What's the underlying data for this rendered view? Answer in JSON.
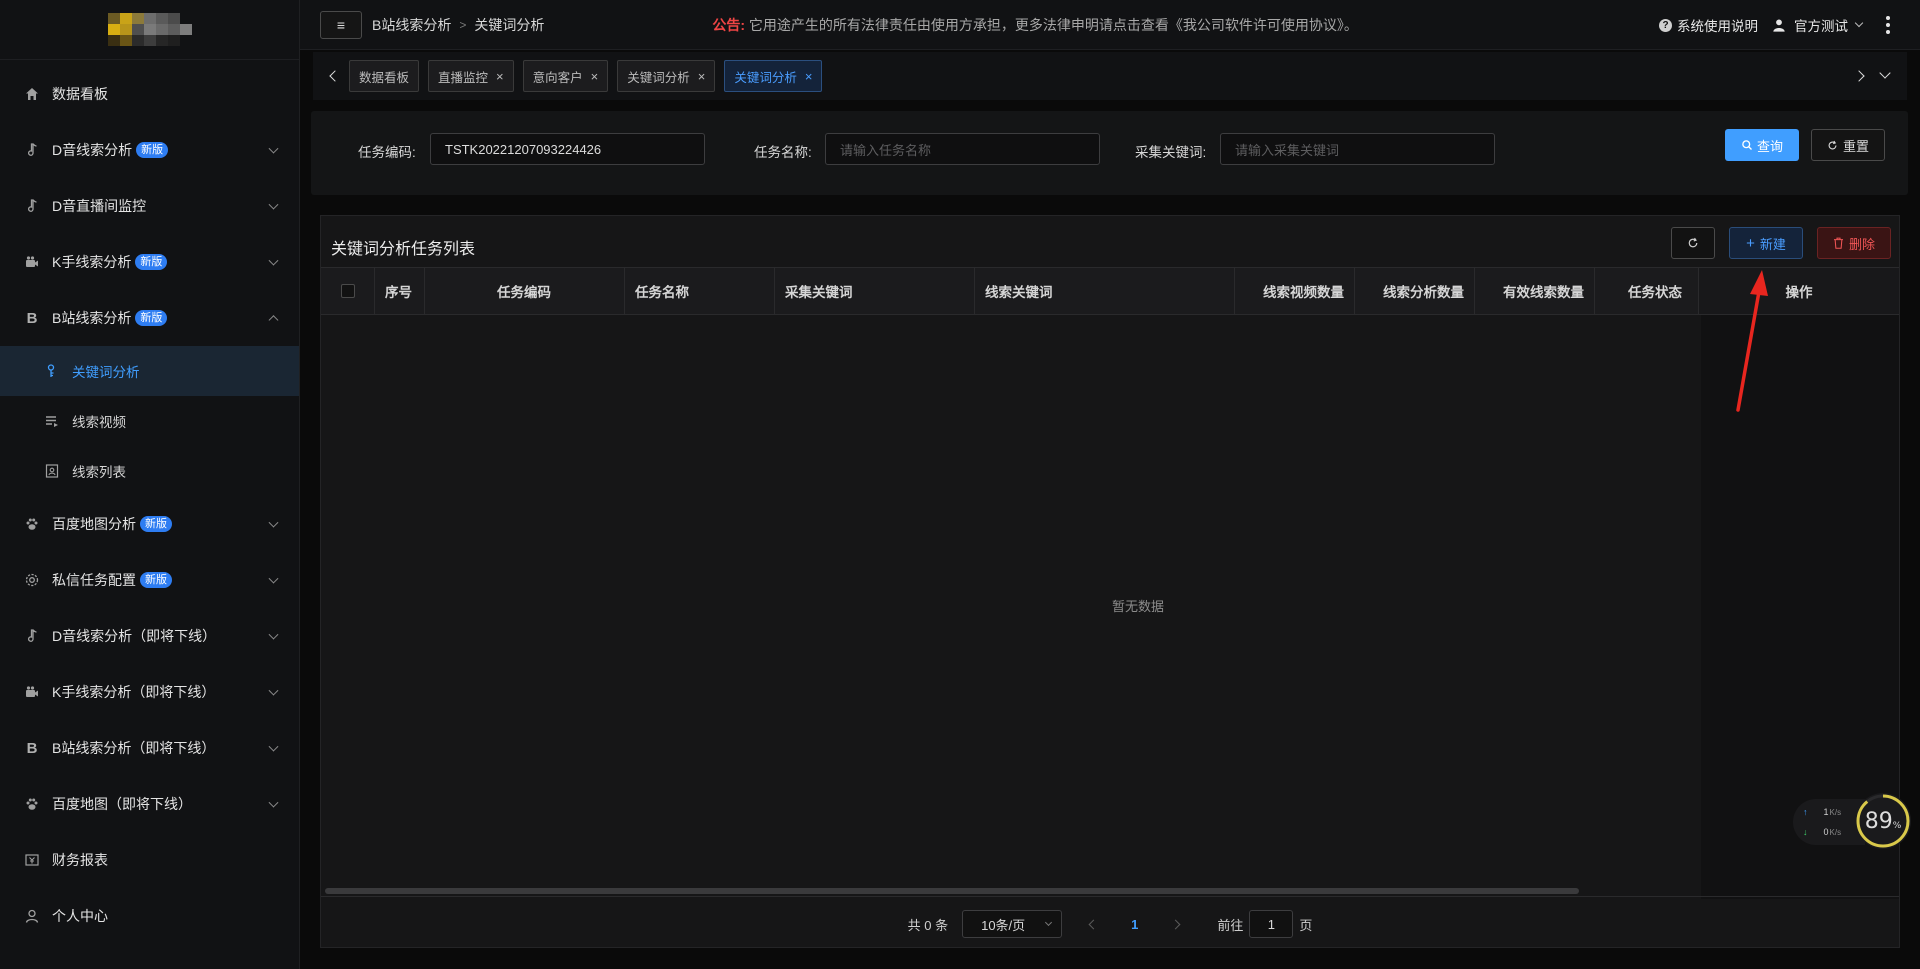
{
  "sidebar": {
    "items": [
      {
        "label": "数据看板",
        "icon": "home-icon"
      },
      {
        "label": "D音线索分析",
        "icon": "music-note-icon",
        "badge": "新版"
      },
      {
        "label": "D音直播间监控",
        "icon": "music-note-icon"
      },
      {
        "label": "K手线索分析",
        "icon": "camera-icon",
        "badge": "新版"
      },
      {
        "label": "B站线索分析",
        "icon": "letter-b-icon",
        "badge": "新版"
      },
      {
        "label": "百度地图分析",
        "icon": "paw-icon",
        "badge": "新版"
      },
      {
        "label": "私信任务配置",
        "icon": "gear-icon",
        "badge": "新版"
      },
      {
        "label": "D音线索分析（即将下线）",
        "icon": "music-note-icon"
      },
      {
        "label": "K手线索分析（即将下线）",
        "icon": "camera-icon"
      },
      {
        "label": "B站线索分析（即将下线）",
        "icon": "letter-b-icon"
      },
      {
        "label": "百度地图（即将下线）",
        "icon": "paw-icon"
      },
      {
        "label": "财务报表",
        "icon": "yen-box-icon"
      },
      {
        "label": "个人中心",
        "icon": "user-icon"
      }
    ],
    "submenu": [
      {
        "label": "关键词分析",
        "icon": "key-icon"
      },
      {
        "label": "线索视频",
        "icon": "playlist-icon"
      },
      {
        "label": "线索列表",
        "icon": "contact-card-icon"
      }
    ]
  },
  "header": {
    "breadcrumb": [
      "B站线索分析",
      "关键词分析"
    ],
    "notice_label": "公告:",
    "notice_text": "它用途产生的所有法律责任由使用方承担，更多法律申明请点击查看《我公司软件许可使用协议》。",
    "help_label": "系统使用说明",
    "user_label": "官方测试"
  },
  "tabs": [
    {
      "label": "数据看板",
      "closable": false
    },
    {
      "label": "直播监控",
      "closable": true
    },
    {
      "label": "意向客户",
      "closable": true
    },
    {
      "label": "关键词分析",
      "closable": true
    },
    {
      "label": "关键词分析",
      "closable": true,
      "active": true
    }
  ],
  "search": {
    "task_code_label": "任务编码:",
    "task_code_value": "TSTK20221207093224426",
    "task_name_label": "任务名称:",
    "task_name_placeholder": "请输入任务名称",
    "keyword_label": "采集关键词:",
    "keyword_placeholder": "请输入采集关键词",
    "query_label": "查询",
    "reset_label": "重置"
  },
  "table": {
    "title": "关键词分析任务列表",
    "new_label": "新建",
    "delete_label": "删除",
    "columns": [
      "序号",
      "任务编码",
      "任务名称",
      "采集关键词",
      "线索关键词",
      "线索视频数量",
      "线索分析数量",
      "有效线索数量",
      "任务状态",
      "操作"
    ],
    "empty_text": "暂无数据"
  },
  "pagination": {
    "total_text": "共 0 条",
    "page_size": "10条/页",
    "current_page": "1",
    "goto_label": "前往",
    "goto_value": "1",
    "page_suffix": "页"
  },
  "net_widget": {
    "up_value": "1",
    "up_unit": "K/s",
    "down_value": "0",
    "down_unit": "K/s",
    "percent": "89",
    "percent_unit": "%"
  },
  "colors": {
    "accent": "#409eff",
    "badge": "#2e7df2",
    "danger": "#f05555",
    "notice_label": "#f04545",
    "annotation_arrow": "#e8261f"
  }
}
